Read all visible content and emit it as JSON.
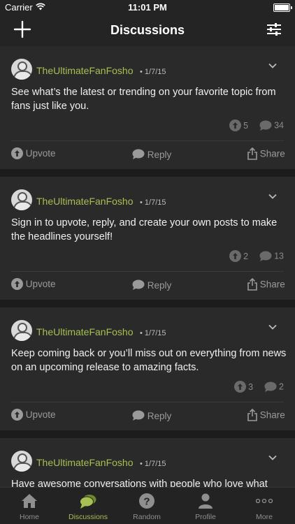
{
  "status_bar": {
    "carrier": "Carrier",
    "time": "11:01 PM"
  },
  "nav": {
    "title": "Discussions"
  },
  "posts": [
    {
      "username": "TheUltimateFanFosho",
      "date": "• 1/7/15",
      "text": "See what’s the latest or trending on your favorite topic from fans just like you.",
      "upvotes": "5",
      "replies": "34"
    },
    {
      "username": "TheUltimateFanFosho",
      "date": "• 1/7/15",
      "text": "Sign in to upvote, reply, and create your own posts to make the headlines yourself!",
      "upvotes": "2",
      "replies": "13"
    },
    {
      "username": "TheUltimateFanFosho",
      "date": "• 1/7/15",
      "text": "Keep coming back or you’ll miss out on everything from news on an upcoming release to amazing facts.",
      "upvotes": "3",
      "replies": "2"
    },
    {
      "username": "TheUltimateFanFosho",
      "date": "• 1/7/15",
      "text": "Have awesome conversations with people who love what"
    }
  ],
  "actions": {
    "upvote": "Upvote",
    "reply": "Reply",
    "share": "Share"
  },
  "tabs": [
    {
      "label": "Home"
    },
    {
      "label": "Discussions"
    },
    {
      "label": "Random"
    },
    {
      "label": "Profile"
    },
    {
      "label": "More"
    }
  ],
  "colors": {
    "accent": "#a7bf53",
    "background": "#1c1c1c",
    "card": "#2a2a2a"
  }
}
